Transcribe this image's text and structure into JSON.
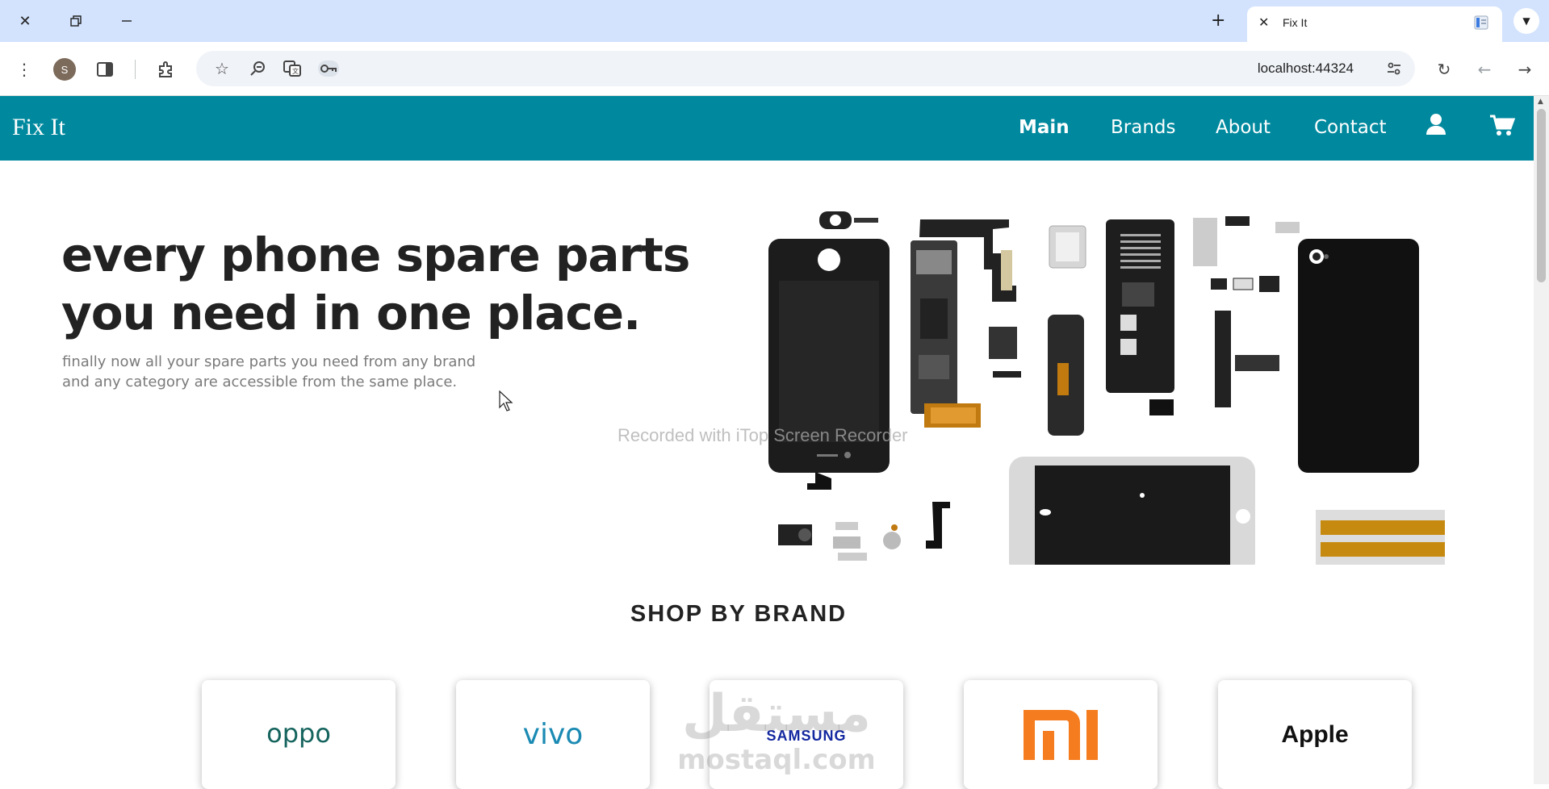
{
  "browser": {
    "tab_title": "Fix It",
    "url": "localhost:44324",
    "profile_initial": "S",
    "icons": [
      "close-window-icon",
      "restore-window-icon",
      "minimize-window-icon",
      "new-tab-icon",
      "tab-close-icon",
      "tab-search-chevron-icon",
      "menu-icon",
      "sidebar-icon",
      "extensions-icon",
      "bookmark-star-icon",
      "zoom-icon",
      "translate-icon",
      "password-key-icon",
      "site-settings-icon",
      "reload-icon",
      "back-icon",
      "forward-icon"
    ]
  },
  "site": {
    "brand": "Fix It",
    "nav": [
      {
        "label": "Main",
        "active": true
      },
      {
        "label": "Brands",
        "active": false
      },
      {
        "label": "About",
        "active": false
      },
      {
        "label": "Contact",
        "active": false
      }
    ],
    "nav_icons": [
      "user-icon",
      "cart-icon"
    ],
    "accent_color": "#00899e"
  },
  "hero": {
    "title": "every phone spare parts you need in one place.",
    "subtitle": "finally now all your spare parts you need from any brand and any category are accessible from the same place."
  },
  "watermark": "Recorded with iTop Screen Recorder",
  "shop_by_brand": {
    "title": "SHOP BY BRAND",
    "brands": [
      "oppo",
      "vivo",
      "SAMSUNG",
      "mi",
      "Apple"
    ]
  },
  "overlay_watermark": {
    "arabic": "مستقل",
    "latin": "mostaql.com"
  }
}
